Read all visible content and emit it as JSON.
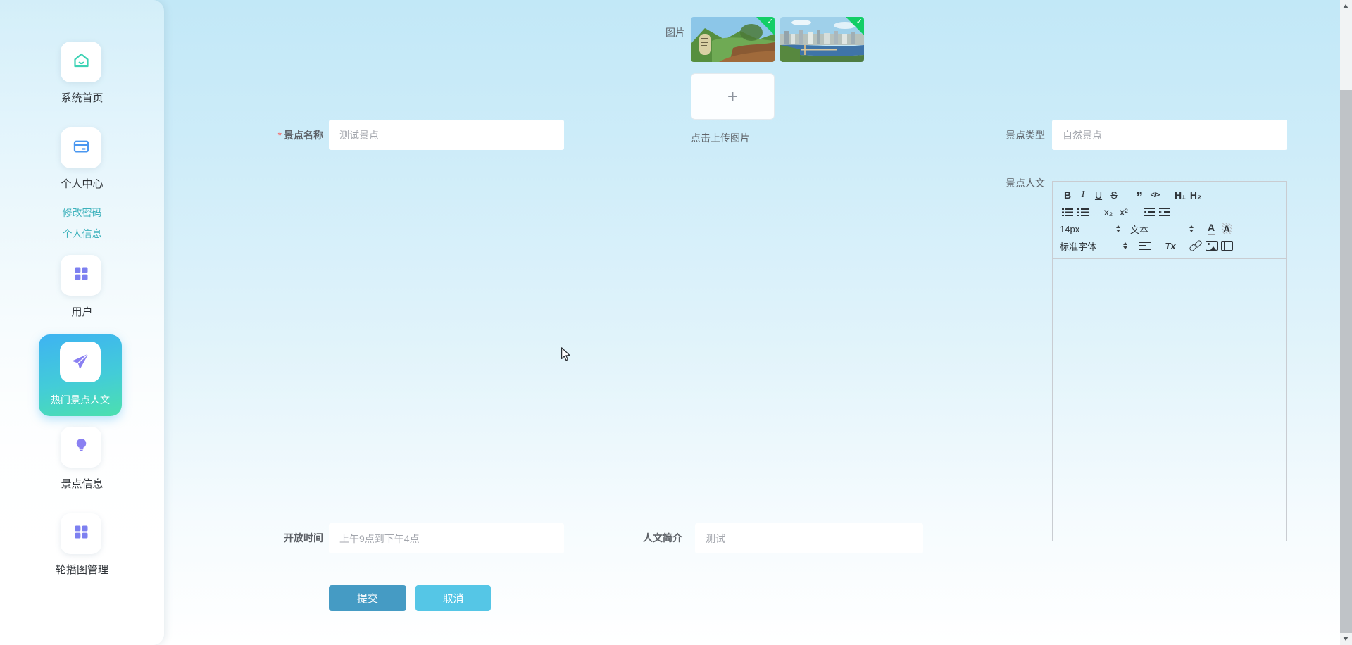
{
  "colors": {
    "accent_gradient_start": "#3eb3f2",
    "accent_gradient_end": "#4ce0ae",
    "sidebar_link": "#3eb2bc",
    "submit_bg": "#459bc4",
    "cancel_bg": "#55c6e6",
    "badge_green": "#13ce66",
    "required_red": "#f56c6c"
  },
  "sidebar": {
    "items": [
      {
        "label": "系统首页",
        "icon": "home-icon"
      },
      {
        "label": "个人中心",
        "icon": "bank-card-icon"
      },
      {
        "label": "修改密码",
        "type": "link"
      },
      {
        "label": "个人信息",
        "type": "link"
      },
      {
        "label": "用户",
        "icon": "grid-icon"
      },
      {
        "label": "热门景点人文",
        "icon": "paper-plane-icon",
        "active": true
      },
      {
        "label": "景点信息",
        "icon": "lightbulb-icon"
      },
      {
        "label": "轮播图管理",
        "icon": "grid-icon"
      }
    ]
  },
  "form": {
    "image": {
      "label": "图片",
      "hint": "点击上传图片",
      "plus": "+",
      "check": "✓",
      "thumbnails": [
        {
          "name": "mountain-landscape-photo",
          "uploaded": true
        },
        {
          "name": "city-river-photo",
          "uploaded": true
        }
      ]
    },
    "name": {
      "label": "景点名称",
      "required_mark": "*",
      "value": "测试景点"
    },
    "type": {
      "label": "景点类型",
      "value": "自然景点"
    },
    "culture": {
      "label": "景点人文"
    },
    "open_time": {
      "label": "开放时间",
      "value": "上午9点到下午4点"
    },
    "intro": {
      "label": "人文简介",
      "value": "测试"
    },
    "submit_label": "提交",
    "cancel_label": "取消"
  },
  "editor": {
    "toolbar": {
      "bold": "B",
      "italic": "I",
      "underline": "U",
      "strike": "S",
      "blockquote": "”",
      "code_block": "</>",
      "h1": "H₁",
      "h2": "H₂",
      "subscript": "x₂",
      "superscript": "x²",
      "size_value": "14px",
      "header_value": "文本",
      "color": "A",
      "background": "A",
      "font_value": "标准字体",
      "clean": "Tx"
    }
  }
}
